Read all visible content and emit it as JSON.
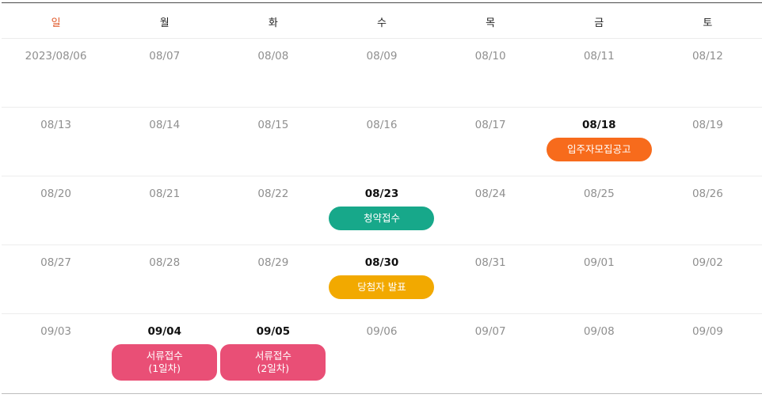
{
  "weekdays": [
    "일",
    "월",
    "화",
    "수",
    "목",
    "금",
    "토"
  ],
  "weeks": [
    [
      {
        "date": "2023/08/06"
      },
      {
        "date": "08/07"
      },
      {
        "date": "08/08"
      },
      {
        "date": "08/09"
      },
      {
        "date": "08/10"
      },
      {
        "date": "08/11"
      },
      {
        "date": "08/12"
      }
    ],
    [
      {
        "date": "08/13"
      },
      {
        "date": "08/14"
      },
      {
        "date": "08/15"
      },
      {
        "date": "08/16"
      },
      {
        "date": "08/17"
      },
      {
        "date": "08/18",
        "active": true,
        "event": {
          "label": "입주자모집공고",
          "color": "#f76b1c"
        }
      },
      {
        "date": "08/19"
      }
    ],
    [
      {
        "date": "08/20"
      },
      {
        "date": "08/21"
      },
      {
        "date": "08/22"
      },
      {
        "date": "08/23",
        "active": true,
        "event": {
          "label": "청약접수",
          "color": "#17a88a"
        }
      },
      {
        "date": "08/24"
      },
      {
        "date": "08/25"
      },
      {
        "date": "08/26"
      }
    ],
    [
      {
        "date": "08/27"
      },
      {
        "date": "08/28"
      },
      {
        "date": "08/29"
      },
      {
        "date": "08/30",
        "active": true,
        "event": {
          "label": "당첨자 발표",
          "color": "#f2a900"
        }
      },
      {
        "date": "08/31"
      },
      {
        "date": "09/01"
      },
      {
        "date": "09/02"
      }
    ],
    [
      {
        "date": "09/03"
      },
      {
        "date": "09/04",
        "active": true,
        "event": {
          "label": "서류접수\n(1일차)",
          "color": "#e94f76",
          "tall": true
        }
      },
      {
        "date": "09/05",
        "active": true,
        "event": {
          "label": "서류접수\n(2일차)",
          "color": "#e94f76",
          "tall": true
        }
      },
      {
        "date": "09/06"
      },
      {
        "date": "09/07"
      },
      {
        "date": "09/08"
      },
      {
        "date": "09/09"
      }
    ]
  ]
}
